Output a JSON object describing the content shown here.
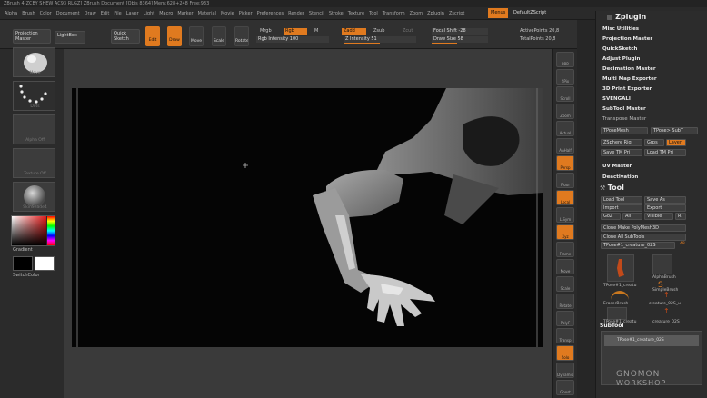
{
  "titlebar": {
    "text": "ZBrush 4[ZCBY SHEW AC93 RLGZ]    ZBrush Document    [Objs 8364] Mem:628+248 Free:933"
  },
  "menu": {
    "items": [
      "Alpha",
      "Brush",
      "Color",
      "Document",
      "Draw",
      "Edit",
      "File",
      "Layer",
      "Light",
      "Macro",
      "Marker",
      "Material",
      "Movie",
      "Picker",
      "Preferences",
      "Render",
      "Stencil",
      "Stroke",
      "Texture",
      "Tool",
      "Transform",
      "Zoom",
      "Zplugin",
      "Zscript"
    ],
    "menus_label": "Menus",
    "default_script": "DefaultZScript"
  },
  "topshelf": {
    "projection_master": "Projection Master",
    "lightbox": "LightBox",
    "quick_sketch": "Quick Sketch",
    "tools": [
      "Edit",
      "Draw",
      "Move",
      "Scale",
      "Rotate"
    ],
    "mrgb": "Mrgb",
    "rgb": "Rgb",
    "m": "M",
    "zadd": "Zadd",
    "zsub": "Zsub",
    "zcut": "Zcut",
    "rgb_intensity": "Rgb Intensity 100",
    "z_intensity": "Z Intensity 51",
    "focal_shift": "Focal Shift -28",
    "draw_size": "Draw Size 58",
    "active_points": "ActivePoints 20,8",
    "total_points": "TotalPoints 20,8"
  },
  "leftshelf": {
    "brush_label": "Move",
    "stroke_label": "Dots",
    "alpha_label": "Alpha Off",
    "texture_label": "Texture Off",
    "material_label": "SkinShade4",
    "gradient_label": "Gradient",
    "switch_color_label": "SwitchColor"
  },
  "righttray": {
    "buttons": [
      "BPR",
      "SPix",
      "Scroll",
      "Zoom",
      "Actual",
      "AAHalf",
      "Persp",
      "Floor",
      "Local",
      "L.Sym",
      "Xyz",
      "Frame",
      "Move",
      "Scale",
      "Rotate",
      "PolyF",
      "Transp",
      "Solo",
      "Dynamic",
      "Ghost"
    ]
  },
  "panel": {
    "title": "Zplugin",
    "items": [
      "Misc Utilities",
      "Projection Master",
      "QuickSketch",
      "Adjust Plugin",
      "Decimation Master",
      "Multi Map Exporter",
      "3D Print Exporter",
      "SVENGALI",
      "SubTool Master",
      "Transpose Master"
    ],
    "tpose_buttons": [
      "TPoseMesh",
      "TPose> SubT"
    ],
    "zsphere_buttons": [
      "ZSphere Rig",
      "Grps",
      "Layer"
    ],
    "save_load": [
      "Save TM Prj",
      "Load TM Prj"
    ],
    "uv_master": "UV Master",
    "deactivation": "Deactivation",
    "tool_title": "Tool",
    "tool_buttons": [
      "Load Tool",
      "Save As",
      "Import",
      "Export",
      "GoZ",
      "All",
      "Visible",
      "R"
    ],
    "clone_make": "Clone  Make PolyMesh3D",
    "clone_all": "Clone All SubTools",
    "current_tool": "TPose#1_creature_02S",
    "brushes": [
      "TPose#1_creatu",
      "AlphaBrush",
      "SimpleBrush",
      "EraserBrush",
      "creature_02S_u",
      "TPose#1_creatu",
      "creature_02S"
    ],
    "brush_count": "48",
    "subtool_title": "SubTool",
    "subtool_item": "TPose#1_creature_02S"
  },
  "watermark": {
    "line1": "GNOMON",
    "line2": "WORKSHOP"
  }
}
